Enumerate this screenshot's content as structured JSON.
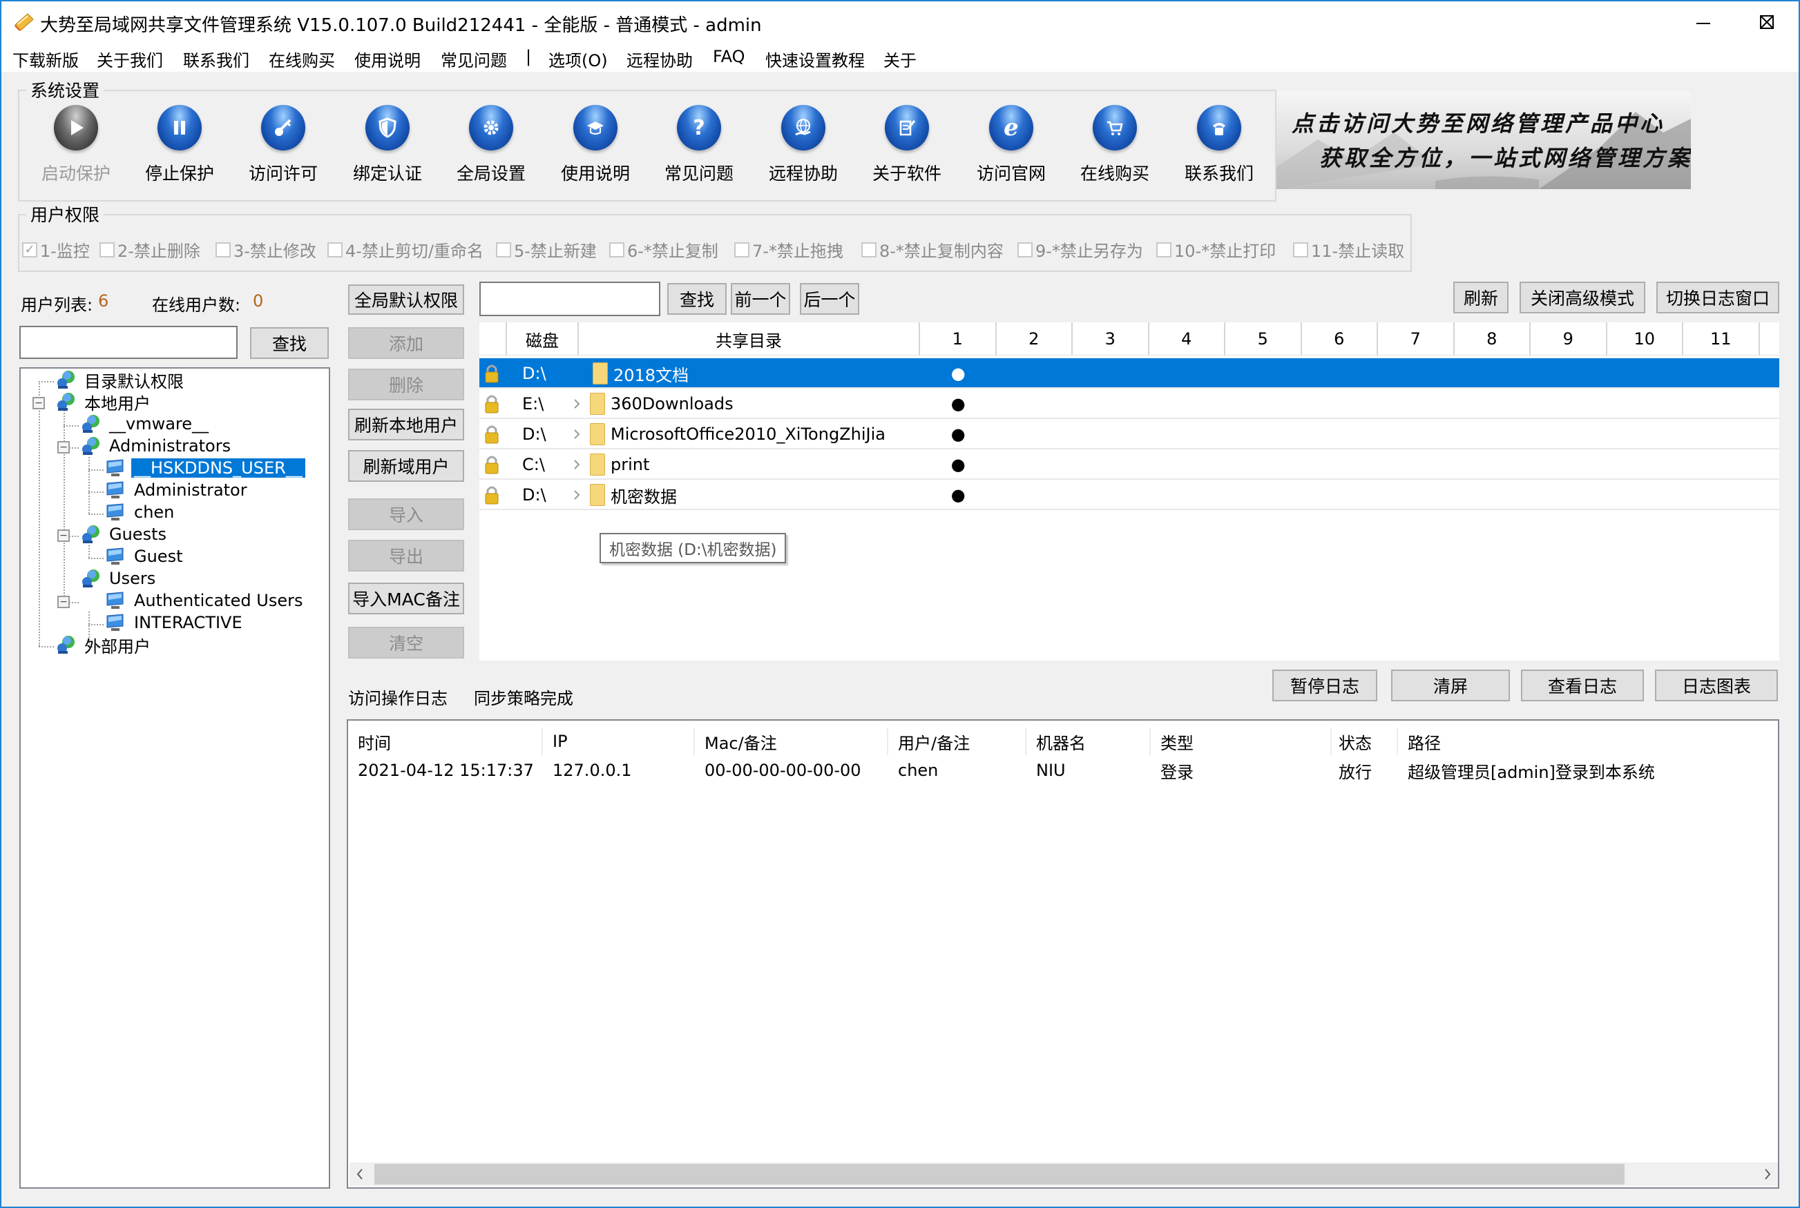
{
  "window": {
    "title": "大势至局域网共享文件管理系统 V15.0.107.0 Build212441 - 全能版 - 普通模式 - admin",
    "controls": [
      "minimize",
      "maximize",
      "close"
    ]
  },
  "menu": {
    "items": [
      "下载新版",
      "关于我们",
      "联系我们",
      "在线购买",
      "使用说明",
      "常见问题",
      "|",
      "选项(O)",
      "远程协助",
      "FAQ",
      "快速设置教程",
      "关于"
    ]
  },
  "system_settings": {
    "title": "系统设置",
    "buttons": [
      {
        "label": "启动保护",
        "icon": "play-icon",
        "enabled": false
      },
      {
        "label": "停止保护",
        "icon": "pause-icon",
        "enabled": true
      },
      {
        "label": "访问许可",
        "icon": "key-icon",
        "enabled": true
      },
      {
        "label": "绑定认证",
        "icon": "shield-icon",
        "enabled": true
      },
      {
        "label": "全局设置",
        "icon": "gear-icon",
        "enabled": true
      },
      {
        "label": "使用说明",
        "icon": "graduation-cap-icon",
        "enabled": true
      },
      {
        "label": "常见问题",
        "icon": "question-icon",
        "enabled": true
      },
      {
        "label": "远程协助",
        "icon": "globe-hand-icon",
        "enabled": true
      },
      {
        "label": "关于软件",
        "icon": "document-pen-icon",
        "enabled": true
      },
      {
        "label": "访问官网",
        "icon": "ie-icon",
        "enabled": true
      },
      {
        "label": "在线购买",
        "icon": "cart-icon",
        "enabled": true
      },
      {
        "label": "联系我们",
        "icon": "phone-icon",
        "enabled": true
      }
    ]
  },
  "banner": {
    "line1": "点击访问大势至网络管理产品中心",
    "line2": "获取全方位，一站式网络管理方案！"
  },
  "permissions": {
    "title": "用户权限",
    "items": [
      {
        "label": "1-监控",
        "checked": true
      },
      {
        "label": "2-禁止删除",
        "checked": false
      },
      {
        "label": "3-禁止修改",
        "checked": false
      },
      {
        "label": "4-禁止剪切/重命名",
        "checked": false
      },
      {
        "label": "5-禁止新建",
        "checked": false
      },
      {
        "label": "6-*禁止复制",
        "checked": false
      },
      {
        "label": "7-*禁止拖拽",
        "checked": false
      },
      {
        "label": "8-*禁止复制内容",
        "checked": false
      },
      {
        "label": "9-*禁止另存为",
        "checked": false
      },
      {
        "label": "10-*禁止打印",
        "checked": false
      },
      {
        "label": "11-禁止读取",
        "checked": false
      }
    ]
  },
  "users": {
    "list_label": "用户列表:",
    "list_count": "6",
    "online_label": "在线用户数:",
    "online_count": "0",
    "search_value": "",
    "search_button": "查找",
    "tree": [
      {
        "label": "目录默认权限",
        "type": "group",
        "level": 0
      },
      {
        "label": "本地用户",
        "type": "group",
        "level": 0,
        "expanded": true
      },
      {
        "label": "__vmware__",
        "type": "group",
        "level": 1
      },
      {
        "label": "Administrators",
        "type": "group",
        "level": 1,
        "expanded": true
      },
      {
        "label": "__HSKDDNS_USER__",
        "type": "user",
        "level": 2,
        "selected": true
      },
      {
        "label": "Administrator",
        "type": "user",
        "level": 2
      },
      {
        "label": "chen",
        "type": "user",
        "level": 2
      },
      {
        "label": "Guests",
        "type": "group",
        "level": 1,
        "expanded": true
      },
      {
        "label": "Guest",
        "type": "user",
        "level": 2
      },
      {
        "label": "Users",
        "type": "group",
        "level": 1,
        "expanded": true
      },
      {
        "label": "Authenticated Users",
        "type": "user",
        "level": 2
      },
      {
        "label": "INTERACTIVE",
        "type": "user",
        "level": 2
      },
      {
        "label": "外部用户",
        "type": "group",
        "level": 0
      }
    ]
  },
  "actions": {
    "global_default": "全局默认权限",
    "add": "添加",
    "delete": "删除",
    "refresh_local": "刷新本地用户",
    "refresh_domain": "刷新域用户",
    "import": "导入",
    "export": "导出",
    "import_mac": "导入MAC备注",
    "clear": "清空"
  },
  "share_toolbar": {
    "search_value": "",
    "find": "查找",
    "prev": "前一个",
    "next": "后一个",
    "refresh": "刷新",
    "close_advanced": "关闭高级模式",
    "switch_log": "切换日志窗口"
  },
  "shares": {
    "columns": [
      "",
      "磁盘",
      "共享目录",
      "1",
      "2",
      "3",
      "4",
      "5",
      "6",
      "7",
      "8",
      "9",
      "10",
      "11"
    ],
    "rows": [
      {
        "disk": "D:\\",
        "dir": "2018文档",
        "marks": [
          "●",
          "",
          "",
          "",
          "",
          "",
          "",
          "",
          "",
          "",
          ""
        ],
        "selected": true,
        "expandable": false
      },
      {
        "disk": "E:\\",
        "dir": "360Downloads",
        "marks": [
          "●",
          "",
          "",
          "",
          "",
          "",
          "",
          "",
          "",
          "",
          ""
        ],
        "selected": false,
        "expandable": true
      },
      {
        "disk": "D:\\",
        "dir": "MicrosoftOffice2010_XiTongZhiJia",
        "marks": [
          "●",
          "",
          "",
          "",
          "",
          "",
          "",
          "",
          "",
          "",
          ""
        ],
        "selected": false,
        "expandable": true
      },
      {
        "disk": "C:\\",
        "dir": "print",
        "marks": [
          "●",
          "",
          "",
          "",
          "",
          "",
          "",
          "",
          "",
          "",
          ""
        ],
        "selected": false,
        "expandable": true
      },
      {
        "disk": "D:\\",
        "dir": "机密数据",
        "marks": [
          "●",
          "",
          "",
          "",
          "",
          "",
          "",
          "",
          "",
          "",
          ""
        ],
        "selected": false,
        "expandable": true
      }
    ],
    "tooltip": "机密数据 (D:\\机密数据)"
  },
  "log": {
    "title": "访问操作日志",
    "status": "同步策略完成",
    "buttons": {
      "pause": "暂停日志",
      "clear": "清屏",
      "view": "查看日志",
      "chart": "日志图表"
    },
    "columns": [
      "时间",
      "IP",
      "Mac/备注",
      "用户/备注",
      "机器名",
      "类型",
      "",
      "状态",
      "路径"
    ],
    "rows": [
      {
        "time": "2021-04-12 15:17:37",
        "ip": "127.0.0.1",
        "mac": "00-00-00-00-00-00",
        "user": "chen",
        "machine": "NIU",
        "type": "登录",
        "extra": "",
        "status": "放行",
        "path": "超级管理员[admin]登录到本系统"
      }
    ]
  },
  "colors": {
    "accent": "#0078d7",
    "window_border": "#1e82d2",
    "background": "#f0f0f0"
  }
}
